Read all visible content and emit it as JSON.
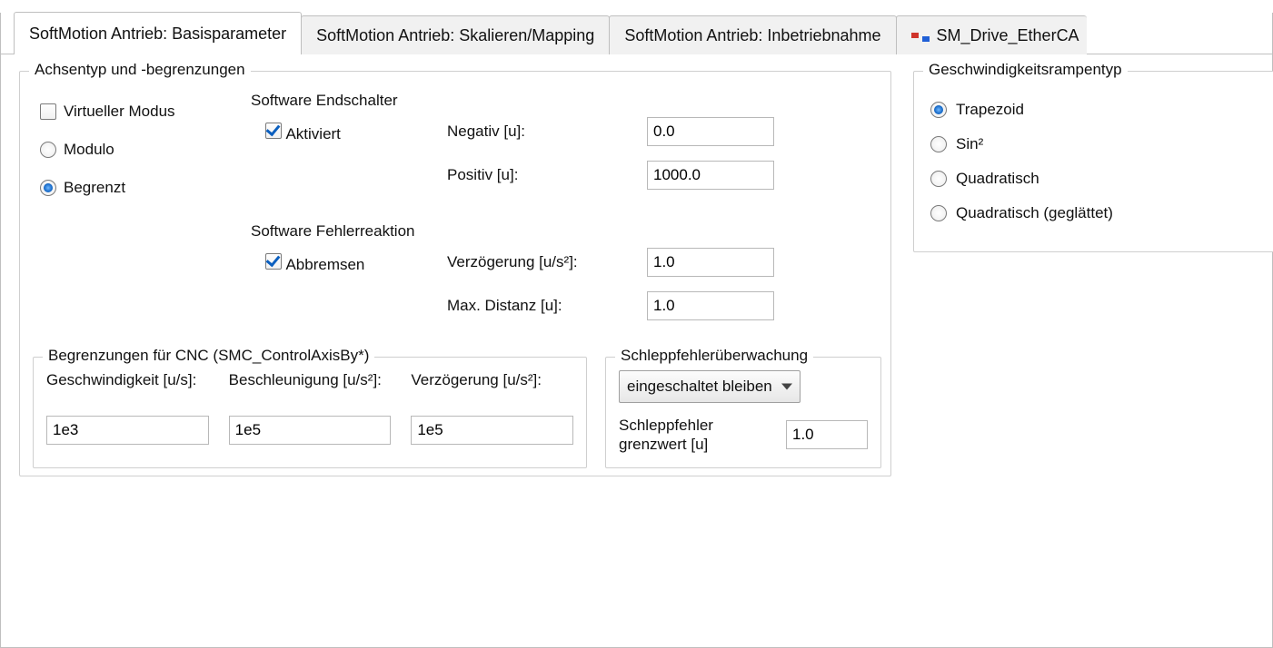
{
  "tabs": {
    "t0": "SoftMotion Antrieb: Basisparameter",
    "t1": "SoftMotion Antrieb: Skalieren/Mapping",
    "t2": "SoftMotion Antrieb: Inbetriebnahme",
    "t3": "SM_Drive_EtherCA"
  },
  "achsen": {
    "legend": "Achsentyp und -begrenzungen",
    "virtual_label": "Virtueller Modus",
    "modulo_label": "Modulo",
    "begrenzt_label": "Begrenzt",
    "sw_end": {
      "title": "Software Endschalter",
      "aktiviert_label": "Aktiviert",
      "neg_label": "Negativ [u]:",
      "neg_value": "0.0",
      "pos_label": "Positiv [u]:",
      "pos_value": "1000.0"
    },
    "sw_fehler": {
      "title": "Software Fehlerreaktion",
      "abbremsen_label": "Abbremsen",
      "verz_label": "Verzögerung [u/s²]:",
      "verz_value": "1.0",
      "maxdist_label": "Max. Distanz [u]:",
      "maxdist_value": "1.0"
    }
  },
  "cnc": {
    "legend": "Begrenzungen für CNC (SMC_ControlAxisBy*)",
    "geschw_label": "Geschwindigkeit [u/s]:",
    "geschw_value": "1e3",
    "beschl_label": "Beschleunigung [u/s²]:",
    "beschl_value": "1e5",
    "verz_label": "Verzögerung [u/s²]:",
    "verz_value": "1e5"
  },
  "schlepp": {
    "legend": "Schleppfehlerüberwachung",
    "select_value": "eingeschaltet bleiben",
    "grenz_label": "Schleppfehler grenzwert [u]",
    "grenz_value": "1.0"
  },
  "ramp": {
    "legend": "Geschwindigkeitsrampentyp",
    "r0": "Trapezoid",
    "r1": "Sin²",
    "r2": "Quadratisch",
    "r3": "Quadratisch (geglättet)"
  }
}
